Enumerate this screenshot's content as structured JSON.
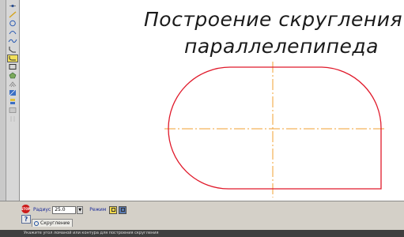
{
  "canvas": {
    "title_line1": "Построение скругления",
    "title_line2": "параллелепипеда",
    "shape_color": "#e0192a",
    "axis_color": "#f0a030"
  },
  "toolbar": {
    "tools": [
      {
        "icon": "point-icon"
      },
      {
        "icon": "line-icon"
      },
      {
        "icon": "circle-icon"
      },
      {
        "icon": "arc-icon"
      },
      {
        "icon": "spline-icon"
      },
      {
        "icon": "chamfer-icon"
      },
      {
        "icon": "fillet-icon",
        "active": true
      },
      {
        "icon": "rectangle-icon"
      },
      {
        "icon": "polygon-icon"
      },
      {
        "icon": "offset-icon"
      },
      {
        "icon": "hatch-icon"
      },
      {
        "icon": "dimension-icon"
      },
      {
        "icon": "text-icon"
      },
      {
        "icon": "grid-icon"
      }
    ]
  },
  "property_bar": {
    "radius_label": "Радиус",
    "radius_value": "25.0",
    "mode_label": "Режим",
    "tab_label": "Скругление",
    "stop_label": "STOP",
    "help_label": "?"
  },
  "status_bar": {
    "message": "Укажите угол ломаной или контура для построения скругления"
  }
}
